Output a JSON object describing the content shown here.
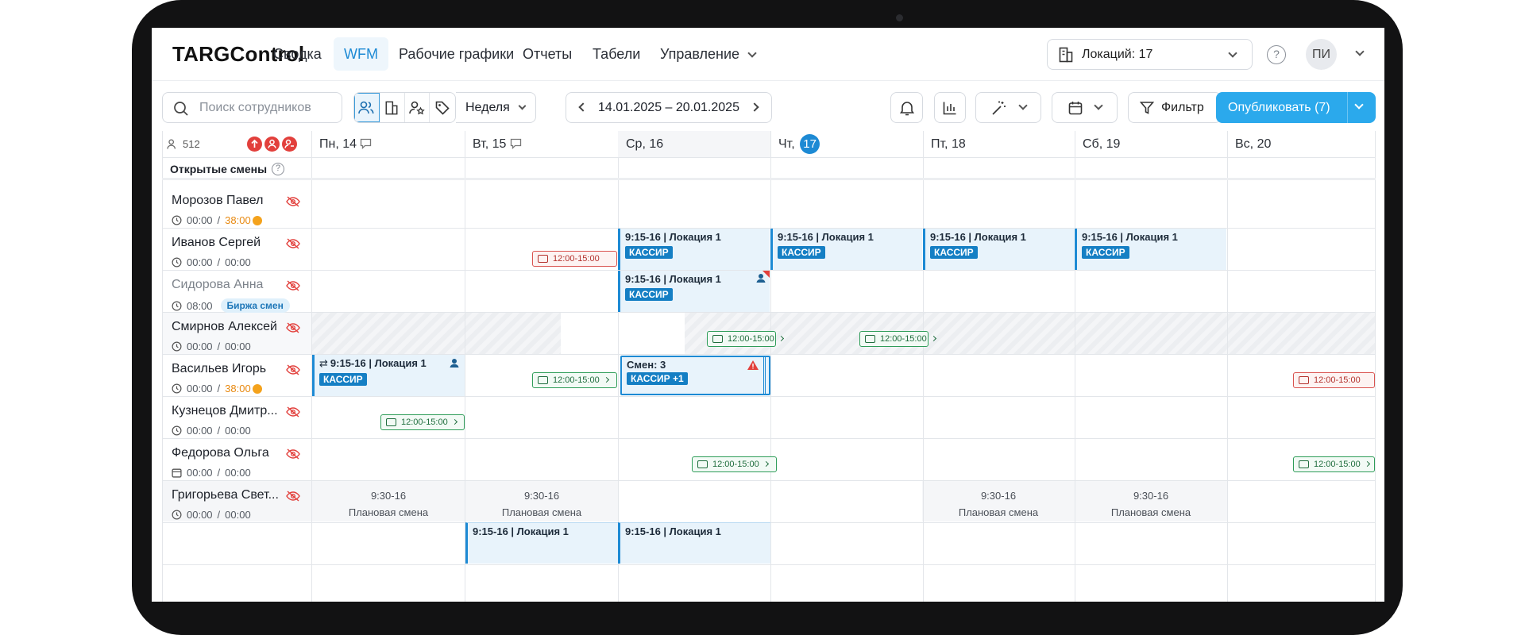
{
  "app": {
    "logo": "TARGControl"
  },
  "nav": {
    "items": [
      {
        "label": "Сводка"
      },
      {
        "label": "WFM",
        "active": true
      },
      {
        "label": "Рабочие графики"
      },
      {
        "label": "Отчеты"
      },
      {
        "label": "Табели"
      },
      {
        "label": "Управление"
      }
    ]
  },
  "location": {
    "label": "Локаций: 17"
  },
  "help": {
    "label": "?"
  },
  "user": {
    "initials": "ПИ"
  },
  "toolbar": {
    "search_placeholder": "Поиск сотрудников",
    "period": "Неделя",
    "range": "14.01.2025 – 20.01.2025",
    "filter": "Фильтр",
    "publish": "Опубликовать (7)"
  },
  "grid": {
    "employee_count": "512",
    "open_shifts": "Открытые смены",
    "days": [
      {
        "label": "Пн, 14",
        "comment": true
      },
      {
        "label": "Вт, 15",
        "comment": true
      },
      {
        "label": "Ср, 16"
      },
      {
        "label": "Чт,",
        "today": "17"
      },
      {
        "label": "Пт, 18"
      },
      {
        "label": "Сб, 19"
      },
      {
        "label": "Вс, 20"
      }
    ],
    "rows": [
      {
        "name": "Морозов Павел",
        "time": "00:00",
        "sep": "/",
        "norm": "38:00"
      },
      {
        "name": "Иванов Сергей",
        "time": "00:00",
        "sep": "/",
        "norm": "00:00"
      },
      {
        "name": "Сидорова Анна",
        "time": "08:00",
        "badge": "Биржа смен"
      },
      {
        "name": "Смирнов Алексей",
        "time": "00:00",
        "sep": "/",
        "norm": "00:00"
      },
      {
        "name": "Васильев Игорь",
        "time": "00:00",
        "sep": "/",
        "norm": "38:00"
      },
      {
        "name": "Кузнецов Дмитр...",
        "time": "00:00",
        "sep": "/",
        "norm": "00:00"
      },
      {
        "name": "Федорова Ольга",
        "time": "00:00",
        "sep": "/",
        "norm": "00:00"
      },
      {
        "name": "Григорьева Свет...",
        "time": "00:00",
        "sep": "/",
        "norm": "00:00"
      }
    ],
    "shift_title": "9:15-16 | Локация 1",
    "shift_tag": "КАССИР",
    "multi_title": "Смен: 3",
    "multi_tag": "КАССИР +1",
    "pill_time": "12:00-15:00",
    "plan_time": "9:30-16",
    "plan_label": "Плановая смена"
  },
  "colors": {
    "accent": "#1d8ad4",
    "publish": "#2ba9ec",
    "warning": "#e2403c",
    "success": "#2f9d59",
    "overtime": "#e88a12"
  }
}
